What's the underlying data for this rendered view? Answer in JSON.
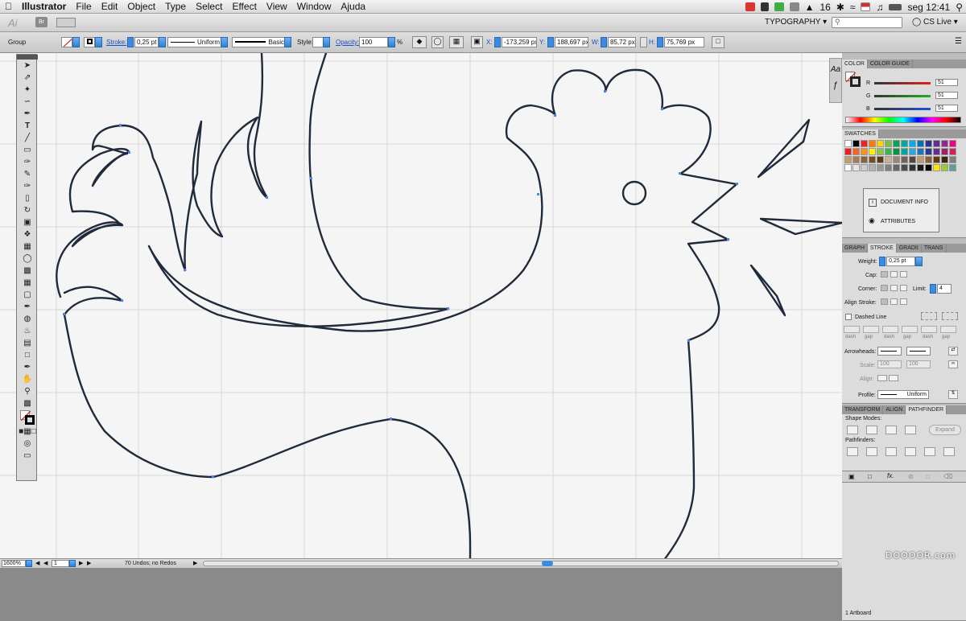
{
  "menubar": {
    "apple": "",
    "items": [
      "Illustrator",
      "File",
      "Edit",
      "Object",
      "Type",
      "Select",
      "Effect",
      "View",
      "Window",
      "Ajuda"
    ],
    "right": {
      "adobe_count": "16",
      "clock": "seg 12:41"
    }
  },
  "appbar": {
    "logo": "Ai",
    "br": "Br",
    "workspace": "TYPOGRAPHY",
    "search_placeholder": "",
    "cs_live": "CS Live"
  },
  "controlbar": {
    "selection": "Group",
    "stroke_label": "Stroke:",
    "stroke_value": "0,25 pt",
    "profile": "Uniform",
    "brush": "Basic",
    "style_label": "Style:",
    "opacity_label": "Opacity:",
    "opacity_value": "100",
    "opacity_unit": "%",
    "x_label": "X:",
    "x_value": "-173,259 px",
    "y_label": "Y:",
    "y_value": "188,697 px",
    "w_label": "W:",
    "w_value": "85,72 px",
    "h_label": "H:",
    "h_value": "75,769 px"
  },
  "statusbar": {
    "zoom": "1600%",
    "artboard": "1",
    "undos": "70 Undos; no Redos"
  },
  "color_panel": {
    "tabs": [
      "COLOR",
      "COLOR GUIDE"
    ],
    "channels": [
      {
        "label": "R",
        "value": "51",
        "color": "#e02020"
      },
      {
        "label": "G",
        "value": "51",
        "color": "#20b020"
      },
      {
        "label": "B",
        "value": "51",
        "color": "#2050e0"
      }
    ]
  },
  "swatches_panel": {
    "title": "SWATCHES"
  },
  "popup": {
    "items": [
      "DOCUMENT INFO",
      "ATTRIBUTES"
    ]
  },
  "stroke_panel": {
    "tabs": [
      "GRAPH",
      "STROKE",
      "GRADII",
      "TRANS"
    ],
    "weight_label": "Weight:",
    "weight_value": "0,25 pt",
    "cap_label": "Cap:",
    "corner_label": "Corner:",
    "limit_label": "Limit:",
    "limit_value": "4",
    "align_label": "Align Stroke:",
    "dashed_label": "Dashed Line",
    "dash_labels": [
      "dash",
      "gap",
      "dash",
      "gap",
      "dash",
      "gap"
    ],
    "arrowheads_label": "Arrowheads:",
    "scale_label": "Scale:",
    "scale_values": [
      "100",
      "100"
    ],
    "align_label2": "Align:",
    "profile_label": "Profile:",
    "profile_value": "Uniform"
  },
  "pathfinder_panel": {
    "tabs": [
      "TRANSFORM",
      "ALIGN",
      "PATHFINDER"
    ],
    "shape_modes_label": "Shape Modes:",
    "expand_label": "Expand",
    "pathfinders_label": "Pathfinders:"
  },
  "bottom_right": {
    "artboards": "1 Artboard"
  },
  "watermark": "DOOOOR.com",
  "colors": {
    "path_stroke": "#1f2a3a",
    "anchor": "#4a86e8",
    "accent": "#3a8be3",
    "canvas": "#f5f5f5"
  },
  "swatch_colors": [
    "#ffffff",
    "#000000",
    "#ee2222",
    "#ff7a00",
    "#ffd400",
    "#7ac143",
    "#00a651",
    "#00a99d",
    "#00aeef",
    "#0072bc",
    "#2e3192",
    "#662d91",
    "#92278f",
    "#ec008c",
    "#ed1c24",
    "#f26522",
    "#f7941d",
    "#fff200",
    "#8dc63f",
    "#39b54a",
    "#009444",
    "#00a79d",
    "#27aae1",
    "#1c75bc",
    "#2b3990",
    "#662d91",
    "#9e1f63",
    "#d91c5c",
    "#c69c6d",
    "#a67c52",
    "#8c6239",
    "#754c24",
    "#603913",
    "#c7b299",
    "#998675",
    "#736357",
    "#534741",
    "#c49a6c",
    "#8b5e3c",
    "#603913",
    "#3c2415",
    "#7f7f7f",
    "#ffffff",
    "#e6e6e6",
    "#cccccc",
    "#b3b3b3",
    "#999999",
    "#808080",
    "#666666",
    "#4d4d4d",
    "#333333",
    "#1a1a1a",
    "#000000",
    "#ffe600",
    "#9acd32",
    "#5f9ea0"
  ]
}
